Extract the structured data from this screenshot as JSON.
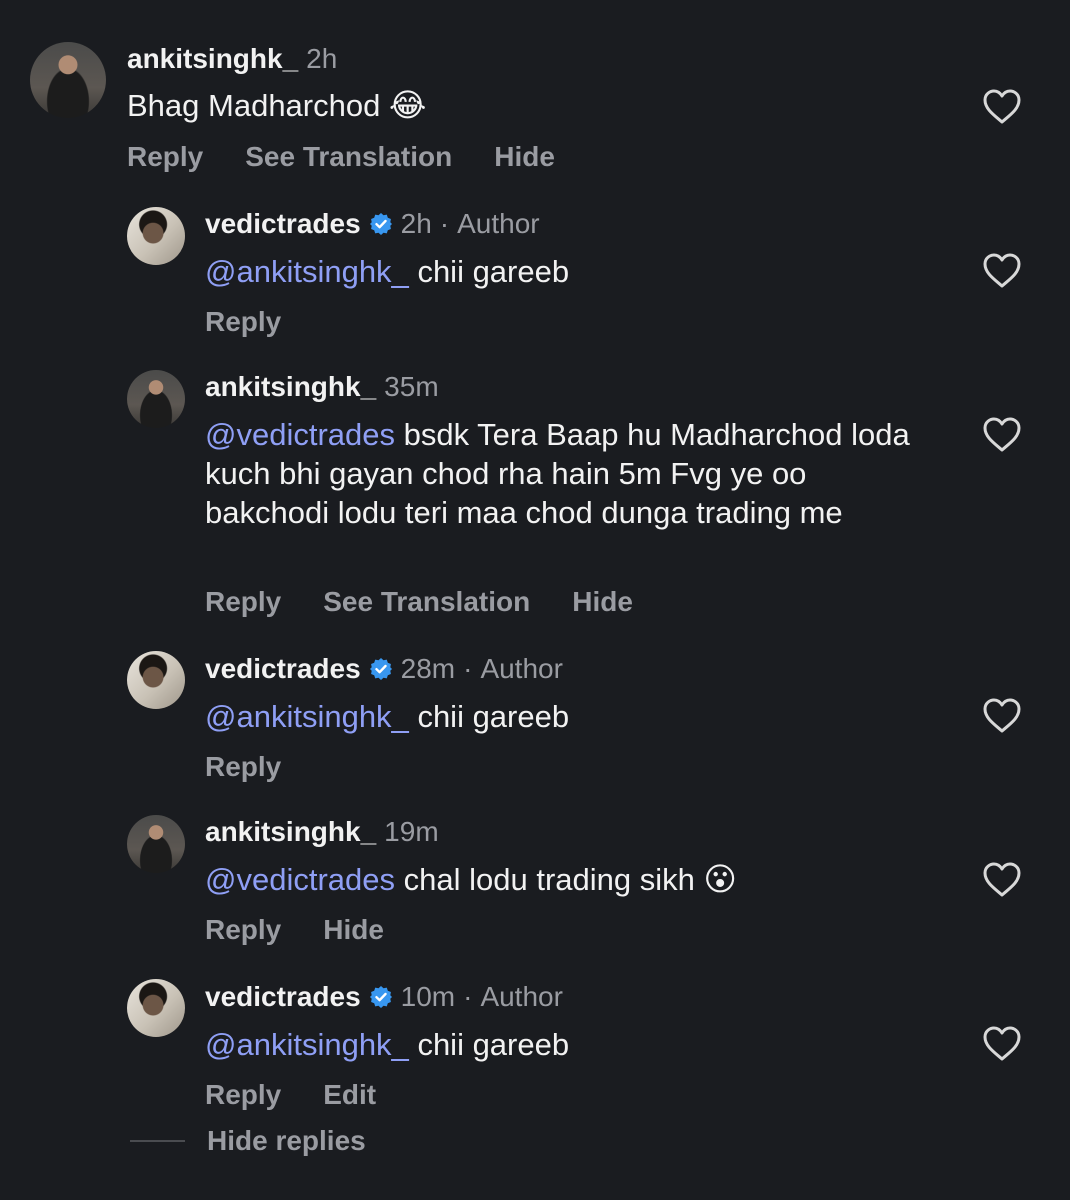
{
  "comments": [
    {
      "username": "ankitsinghk_",
      "time": "2h",
      "author_tag": "",
      "mention": "",
      "text": "Bhag Madharchod",
      "emoji": "😂",
      "actions": [
        "Reply",
        "See Translation",
        "Hide"
      ]
    },
    {
      "username": "vedictrades",
      "time": "2h",
      "author_tag": "Author",
      "mention": "@ankitsinghk_",
      "text": "chii gareeb",
      "emoji": "",
      "actions": [
        "Reply"
      ]
    },
    {
      "username": "ankitsinghk_",
      "time": "35m",
      "author_tag": "",
      "mention": "@vedictrades",
      "text": "bsdk Tera Baap hu Madharchod loda kuch bhi gayan chod rha hain 5m Fvg ye oo bakchodi lodu teri maa chod dunga trading me",
      "emoji": "",
      "actions": [
        "Reply",
        "See Translation",
        "Hide"
      ]
    },
    {
      "username": "vedictrades",
      "time": "28m",
      "author_tag": "Author",
      "mention": "@ankitsinghk_",
      "text": "chii gareeb",
      "emoji": "",
      "actions": [
        "Reply"
      ]
    },
    {
      "username": "ankitsinghk_",
      "time": "19m",
      "author_tag": "",
      "mention": "@vedictrades",
      "text": "chal lodu trading sikh",
      "emoji": "😮",
      "actions": [
        "Reply",
        "Hide"
      ]
    },
    {
      "username": "vedictrades",
      "time": "10m",
      "author_tag": "Author",
      "mention": "@ankitsinghk_",
      "text": "chii gareeb",
      "emoji": "",
      "actions": [
        "Reply",
        "Edit"
      ]
    }
  ],
  "hide_replies_label": "Hide replies",
  "colors": {
    "background": "#1a1c20",
    "text": "#f2f2f2",
    "secondary": "#9a9ca2",
    "mention": "#8f9ff5",
    "verified": "#3897f0"
  },
  "icons": {
    "heart": "heart-outline-icon",
    "verified": "verified-badge-icon"
  }
}
